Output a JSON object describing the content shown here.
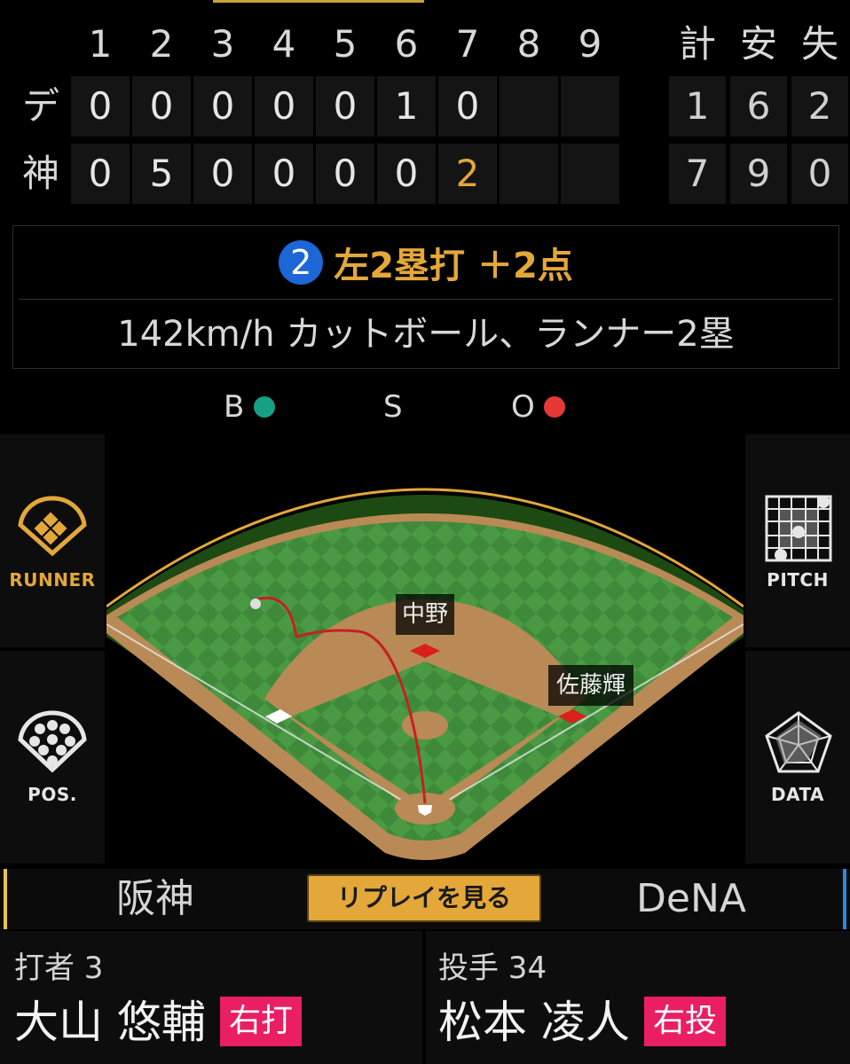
{
  "innings": [
    "1",
    "2",
    "3",
    "4",
    "5",
    "6",
    "7",
    "8",
    "9"
  ],
  "totals_headers": [
    "計",
    "安",
    "失"
  ],
  "teams": [
    {
      "label": "デ",
      "scores": [
        "0",
        "0",
        "0",
        "0",
        "0",
        "1",
        "0",
        "",
        ""
      ],
      "totals": [
        "1",
        "6",
        "2"
      ]
    },
    {
      "label": "神",
      "scores": [
        "0",
        "5",
        "0",
        "0",
        "0",
        "0",
        "2",
        "",
        ""
      ],
      "totals": [
        "7",
        "9",
        "0"
      ]
    }
  ],
  "play": {
    "number": "2",
    "result": "左2塁打 ＋2点",
    "detail": "142km/h カットボール、ランナー2塁"
  },
  "count": {
    "b": "B",
    "s": "S",
    "o": "O"
  },
  "colors": {
    "accent": "#e3a73a",
    "ball": "#16a085",
    "out": "#e53935",
    "badge": "#e91e63",
    "home_tab": "#e8c34a",
    "away_tab": "#2e86de"
  },
  "side_buttons": {
    "runner": "RUNNER",
    "positions": "POS.",
    "pitch": "PITCH",
    "data": "DATA"
  },
  "field_labels": {
    "center": "中野",
    "second": "佐藤輝"
  },
  "tabs": {
    "home": "阪神",
    "away": "DeNA",
    "replay": "リプレイを見る"
  },
  "batter": {
    "role": "打者 3",
    "name": "大山 悠輔",
    "hand": "右打"
  },
  "pitcher": {
    "role": "投手 34",
    "name": "松本 凌人",
    "hand": "右投"
  }
}
